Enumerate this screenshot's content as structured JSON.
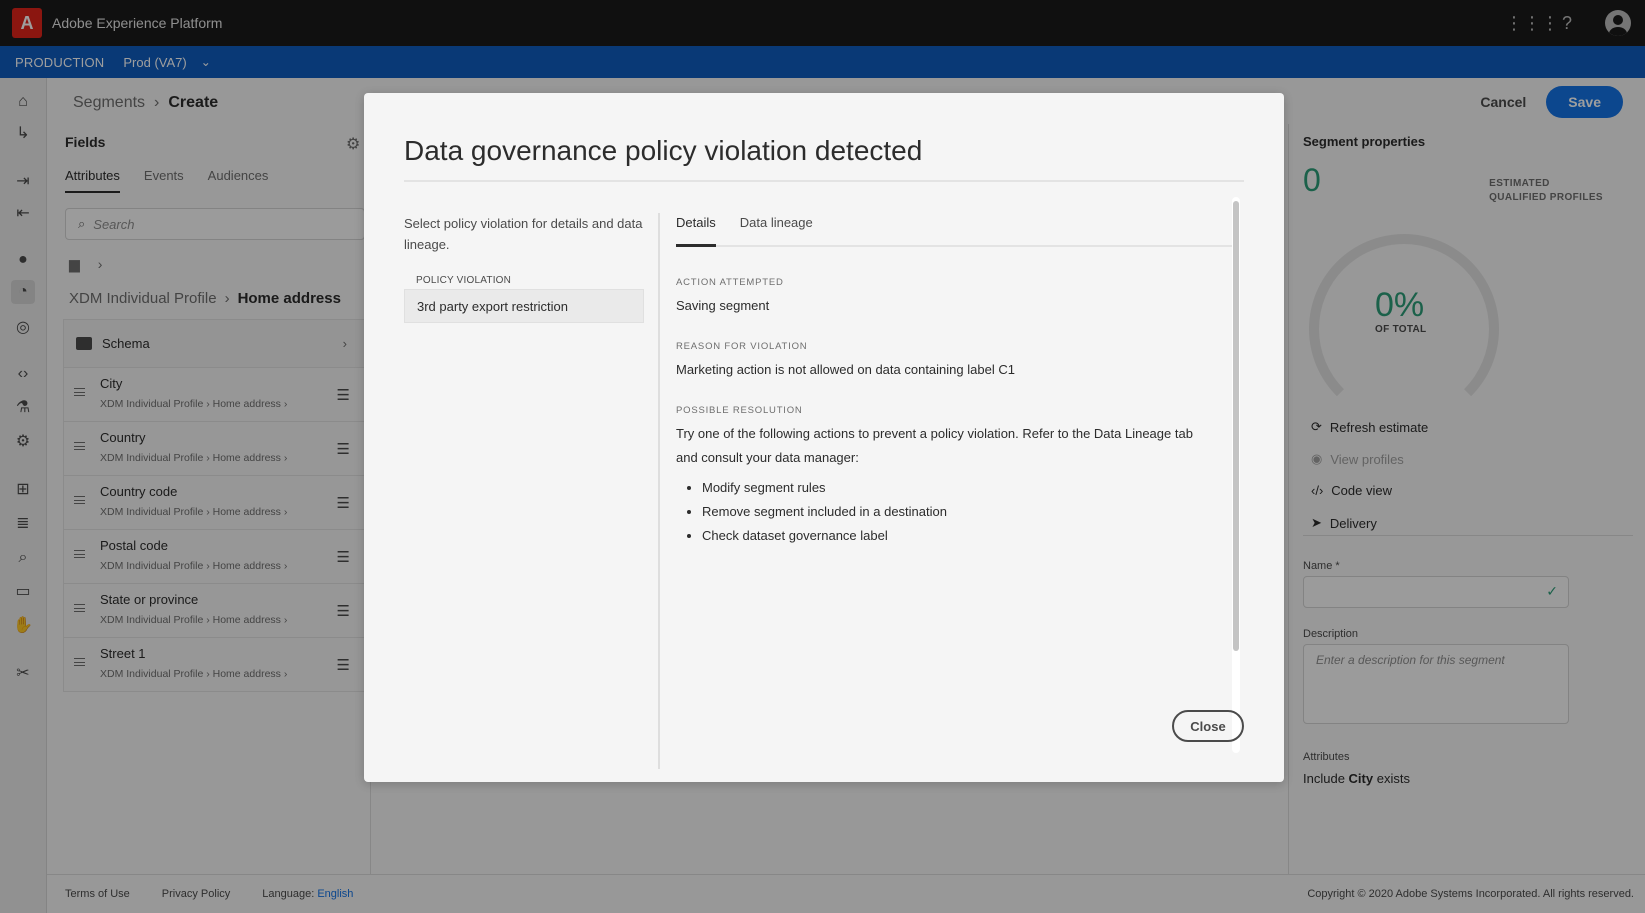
{
  "app": {
    "title": "Adobe Experience Platform",
    "logo_letter": "A"
  },
  "sandbox": {
    "environment": "PRODUCTION",
    "name": "Prod (VA7)"
  },
  "breadcrumb": {
    "parent": "Segments",
    "separator": "›",
    "current": "Create"
  },
  "header": {
    "cancel_label": "Cancel",
    "save_label": "Save"
  },
  "fields": {
    "title": "Fields",
    "tabs": [
      {
        "label": "Attributes",
        "active": true
      },
      {
        "label": "Events",
        "active": false
      },
      {
        "label": "Audiences",
        "active": false
      }
    ],
    "search_placeholder": "Search",
    "path": {
      "root": "XDM Individual Profile",
      "separator": "›",
      "current": "Home address"
    },
    "schema_label": "Schema",
    "items": [
      {
        "name": "City",
        "path": "XDM Individual Profile › Home address ›"
      },
      {
        "name": "Country",
        "path": "XDM Individual Profile › Home address ›"
      },
      {
        "name": "Country code",
        "path": "XDM Individual Profile › Home address ›"
      },
      {
        "name": "Postal code",
        "path": "XDM Individual Profile › Home address ›"
      },
      {
        "name": "State or province",
        "path": "XDM Individual Profile › Home address ›"
      },
      {
        "name": "Street 1",
        "path": "XDM Individual Profile › Home address ›"
      }
    ]
  },
  "properties": {
    "title": "Segment properties",
    "count": "0",
    "estimated_line1": "ESTIMATED",
    "estimated_line2": "QUALIFIED PROFILES",
    "percent": "0%",
    "of_total": "OF TOTAL",
    "actions": [
      {
        "label": "Refresh estimate",
        "icon": "refresh-icon",
        "enabled": true
      },
      {
        "label": "View profiles",
        "icon": "eye-icon",
        "enabled": false
      },
      {
        "label": "Code view",
        "icon": "code-icon",
        "enabled": true
      },
      {
        "label": "Delivery",
        "icon": "send-icon",
        "enabled": true
      }
    ],
    "name_label": "Name *",
    "name_value": "",
    "description_label": "Description",
    "description_placeholder": "Enter a description for this segment",
    "attributes_label": "Attributes",
    "attributes_rule": {
      "prefix": "Include",
      "field": "City",
      "suffix": "exists"
    }
  },
  "modal": {
    "title": "Data governance policy violation detected",
    "intro": "Select policy violation for details and data lineage.",
    "violation_header": "POLICY VIOLATION",
    "violations": [
      "3rd party export restriction"
    ],
    "tabs": [
      {
        "label": "Details",
        "active": true
      },
      {
        "label": "Data lineage",
        "active": false
      }
    ],
    "action_attempted_label": "ACTION ATTEMPTED",
    "action_attempted": "Saving segment",
    "reason_label": "REASON FOR VIOLATION",
    "reason": "Marketing action is not allowed on data containing label C1",
    "resolution_label": "POSSIBLE RESOLUTION",
    "resolution": "Try one of the following actions to prevent a policy violation. Refer to the Data Lineage tab and consult your data manager:",
    "resolution_steps": [
      "Modify segment rules",
      "Remove segment included in a destination",
      "Check dataset governance label"
    ],
    "close_label": "Close"
  },
  "footer": {
    "terms": "Terms of Use",
    "privacy": "Privacy Policy",
    "language_label": "Language:",
    "language_value": "English",
    "copyright": "Copyright © 2020 Adobe Systems Incorporated. All rights reserved."
  },
  "colors": {
    "accent": "#1473e6",
    "sandbox_bar": "#0f5cbe",
    "success": "#2d9d78",
    "topbar": "#1b1b1b"
  }
}
